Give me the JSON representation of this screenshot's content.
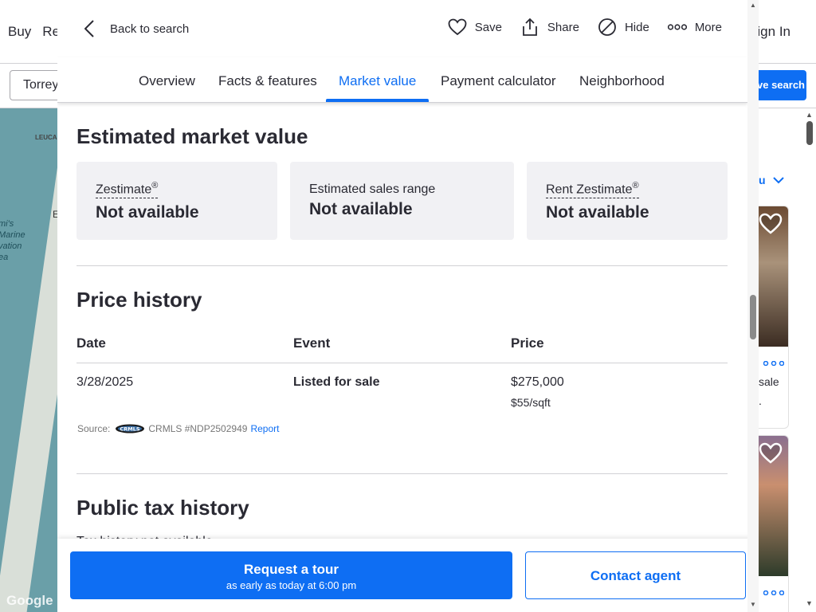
{
  "background": {
    "nav": [
      "Buy",
      "Re"
    ],
    "sign_in": "ign In",
    "search_value": "Torrey",
    "save_search": "ve search",
    "map_label_1": "mi's\nMarine\nvation\nea",
    "map_label_2": "LEUCA",
    "map_label_3": "E",
    "map_logo": "Google",
    "listing_partial_1": "sale",
    "listing_partial_2": "."
  },
  "topbar": {
    "back_label": "Back to search",
    "actions": [
      {
        "icon": "heart-icon",
        "label": "Save"
      },
      {
        "icon": "share-icon",
        "label": "Share"
      },
      {
        "icon": "hide-icon",
        "label": "Hide"
      },
      {
        "icon": "more-icon",
        "label": "More"
      }
    ]
  },
  "tabs": [
    "Overview",
    "Facts & features",
    "Market value",
    "Payment calculator",
    "Neighborhood"
  ],
  "active_tab": "Market value",
  "market_value": {
    "title": "Estimated market value",
    "boxes": [
      {
        "label": "Zestimate",
        "sup": "®",
        "value": "Not available"
      },
      {
        "label": "Estimated sales range",
        "sup": "",
        "value": "Not available"
      },
      {
        "label": "Rent Zestimate",
        "sup": "®",
        "value": "Not available"
      }
    ]
  },
  "price_history": {
    "title": "Price history",
    "columns": [
      "Date",
      "Event",
      "Price"
    ],
    "rows": [
      {
        "date": "3/28/2025",
        "event": "Listed for sale",
        "price": "$275,000",
        "price_per_sqft": "$55/sqft"
      }
    ],
    "source_label": "Source:",
    "source_logo": "CRMLS",
    "source_text": "CRMLS #NDP2502949",
    "report": "Report"
  },
  "public_tax_history": {
    "title": "Public tax history",
    "note": "Tax history not available"
  },
  "footer": {
    "tour_label": "Request a tour",
    "tour_sub": "as early as today at 6:00 pm",
    "contact_label": "Contact agent"
  },
  "colors": {
    "accent": "#0e6ef3",
    "text": "#2a2a33",
    "box_bg": "#f1f1f4"
  }
}
